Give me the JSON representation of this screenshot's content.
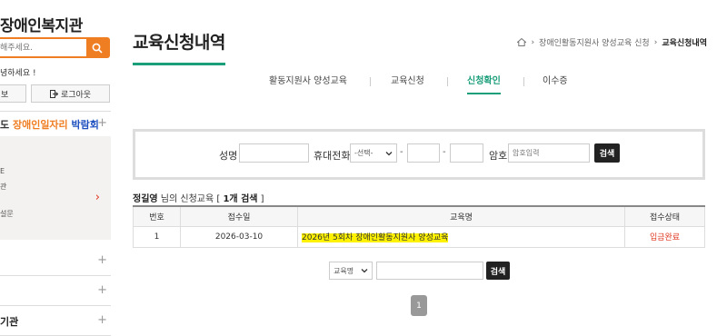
{
  "sidebar": {
    "site_title": "장애인복지관",
    "search_placeholder": "해주세요.",
    "greeting": "녕하세요 !",
    "info_button": "보",
    "logout_button": "로그아웃",
    "menu_first": {
      "part1": "도 ",
      "orange": "장애인일자리",
      "blue": "박람회"
    },
    "sub_items": [
      "E",
      "관",
      "설문"
    ],
    "bottom_row_label": "기관",
    "icons": {
      "search": "search-icon",
      "logout": "logout-icon",
      "plus": "plus-icon",
      "arrow": "chevron-right-icon"
    }
  },
  "main": {
    "page_title": "교육신청내역",
    "breadcrumb": {
      "home_icon": "home-icon",
      "items": [
        "장애인활동지원사 양성교육 신청"
      ],
      "current": "교육신청내역"
    },
    "tabs": [
      {
        "label": "활동지원사 양성교육"
      },
      {
        "label": "교육신청"
      },
      {
        "label": "신청확인"
      },
      {
        "label": "이수증"
      }
    ],
    "search_panel": {
      "name_label": "성명",
      "phone_label": "휴대전화",
      "phone_select": "-선택-",
      "dash": "-",
      "password_label": "암호",
      "password_placeholder": "암호입력",
      "search_button": "검색"
    },
    "result": {
      "user_name": "정길영",
      "text_after_name": " 님의 신청교육 [ ",
      "count": "1개 검색",
      "text_end": " ]"
    },
    "table": {
      "headers": [
        "번호",
        "접수일",
        "교육명",
        "접수상태"
      ],
      "rows": [
        {
          "no": "1",
          "date": "2026-03-10",
          "course": "2026년 5회차 장애인활동지원사 양성교육",
          "status": "입금완료"
        }
      ]
    },
    "bottom_search": {
      "select": "교육명",
      "button": "검색"
    },
    "pagination": {
      "current": "1"
    }
  },
  "colors": {
    "accent_green": "#1b9e7a",
    "accent_orange": "#ef7d22",
    "status_red": "#e0341e",
    "highlight": "#fff200"
  }
}
